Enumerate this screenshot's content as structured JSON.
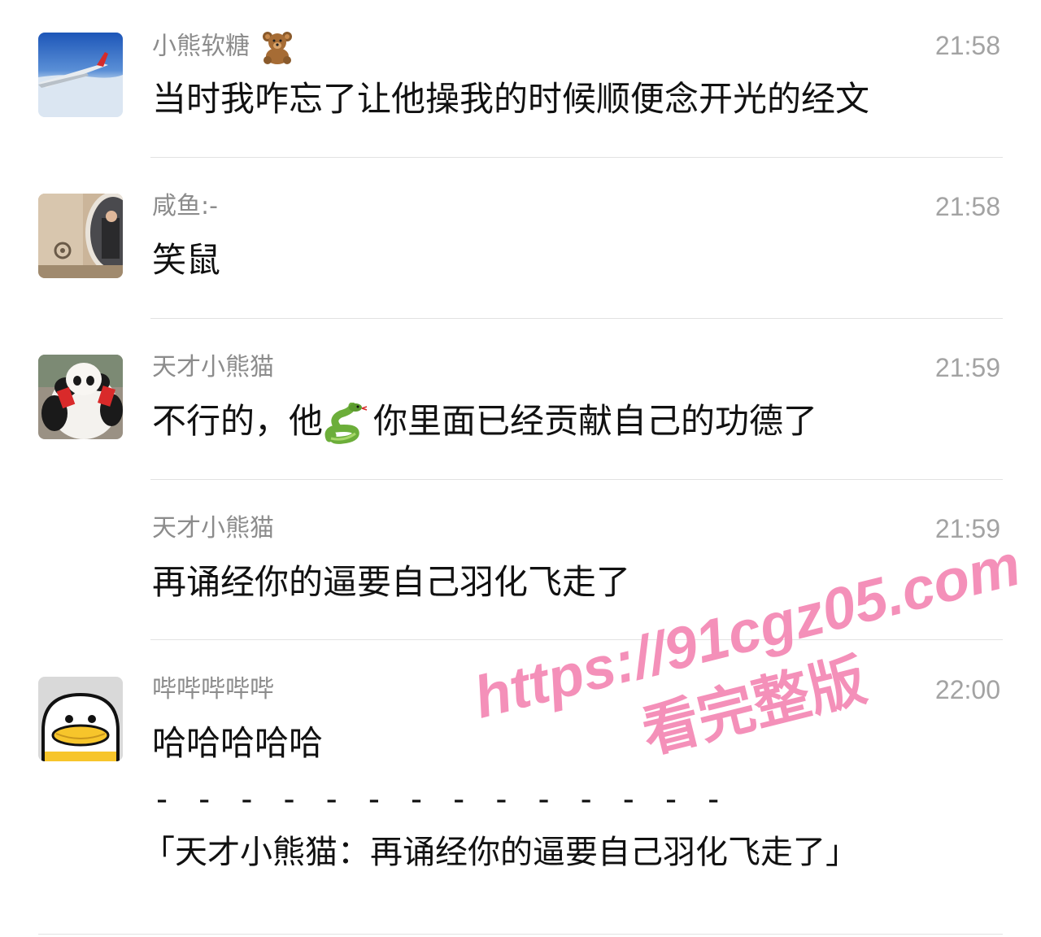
{
  "messages": [
    {
      "sender": "小熊软糖",
      "sender_emoji": "teddy-bear-icon",
      "time": "21:58",
      "text": "当时我咋忘了让他操我的时候顺便念开光的经文"
    },
    {
      "sender": "咸鱼:-",
      "time": "21:58",
      "text": "笑鼠"
    },
    {
      "sender": "天才小熊猫",
      "time": "21:59",
      "text_before_emoji": "不行的，他",
      "inline_emoji": "snake-icon",
      "text_after_emoji": "你里面已经贡献自己的功德了"
    },
    {
      "sender": "天才小熊猫",
      "time": "21:59",
      "text": "再诵经你的逼要自己羽化飞走了"
    },
    {
      "sender": "哔哔哔哔哔",
      "time": "22:00",
      "text": "哈哈哈哈哈",
      "quote_separator": "- - - - - - - - - - - - - -",
      "quote": "「天才小熊猫：再诵经你的逼要自己羽化飞走了」"
    }
  ],
  "watermark": {
    "url": "https://91cgz05.com",
    "sub": "看完整版"
  },
  "colors": {
    "sender": "#8c8c8c",
    "time": "#a3a3a3",
    "text": "#111111",
    "divider": "#e2e2e2",
    "watermark": "#f178aa"
  }
}
